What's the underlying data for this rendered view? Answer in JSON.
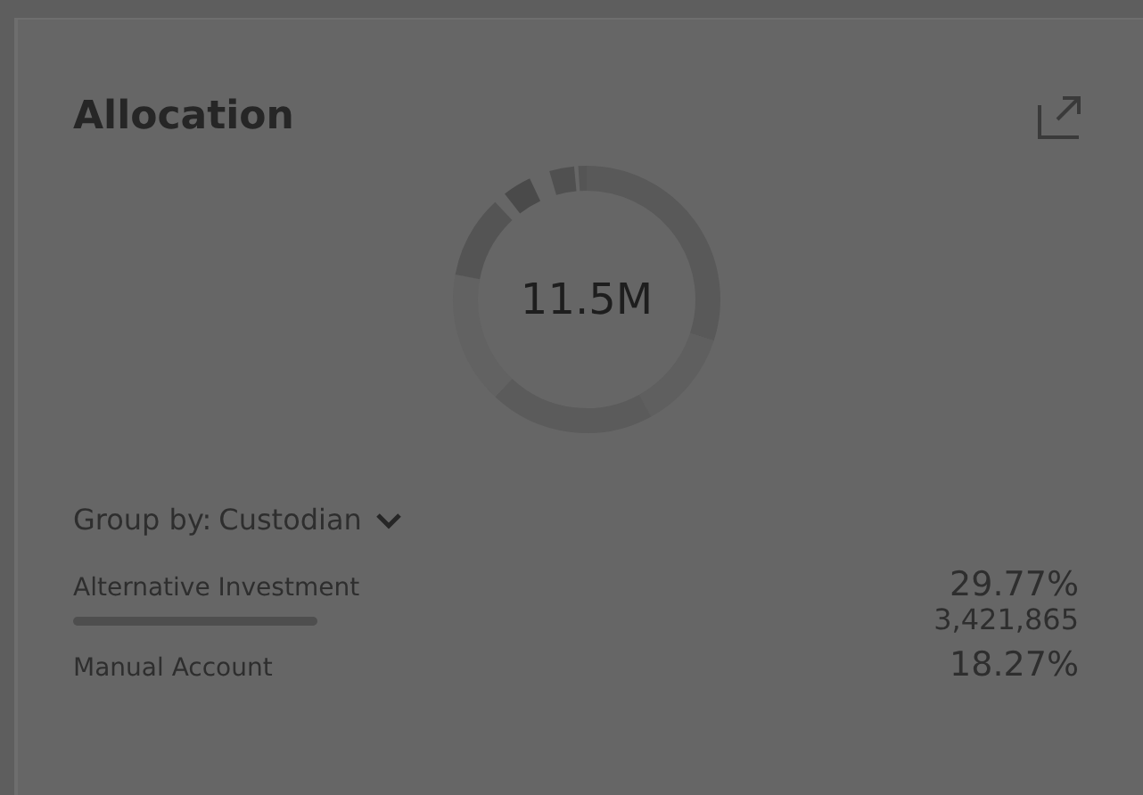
{
  "card": {
    "title": "Allocation",
    "donut": {
      "center_label": "11.5M"
    },
    "group_by": {
      "label": "Group by:",
      "value": "Custodian"
    },
    "rows": [
      {
        "name": "Alternative Investment",
        "percent": "29.77%",
        "amount": "3,421,865"
      },
      {
        "name": "Manual Account",
        "percent": "18.27%"
      }
    ]
  }
}
